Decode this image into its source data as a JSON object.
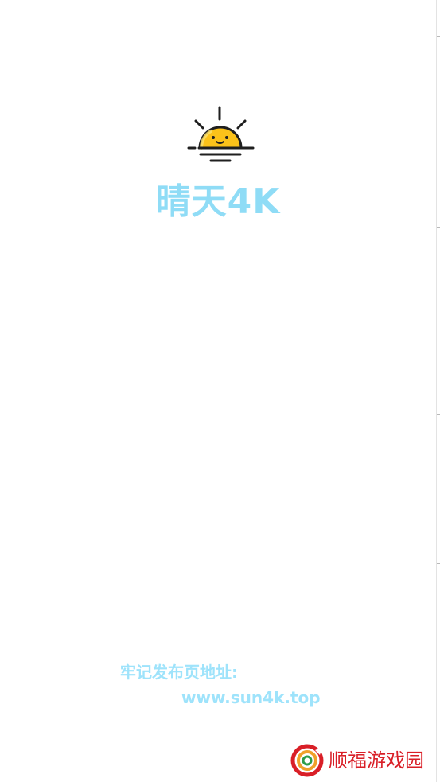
{
  "app": {
    "title": "晴天4K",
    "logo_icon": "rising-sun-icon"
  },
  "release_info": {
    "label": "牢记发布页地址:",
    "url": "www.sun4k.top"
  },
  "watermark": {
    "text": "顺福游戏园",
    "logo_icon": "shunfu-logo-icon"
  },
  "colors": {
    "title": "#8fdcf6",
    "release_text": "#9ee3fb",
    "sun_fill": "#fbc21a",
    "watermark_red": "#d91f27"
  }
}
